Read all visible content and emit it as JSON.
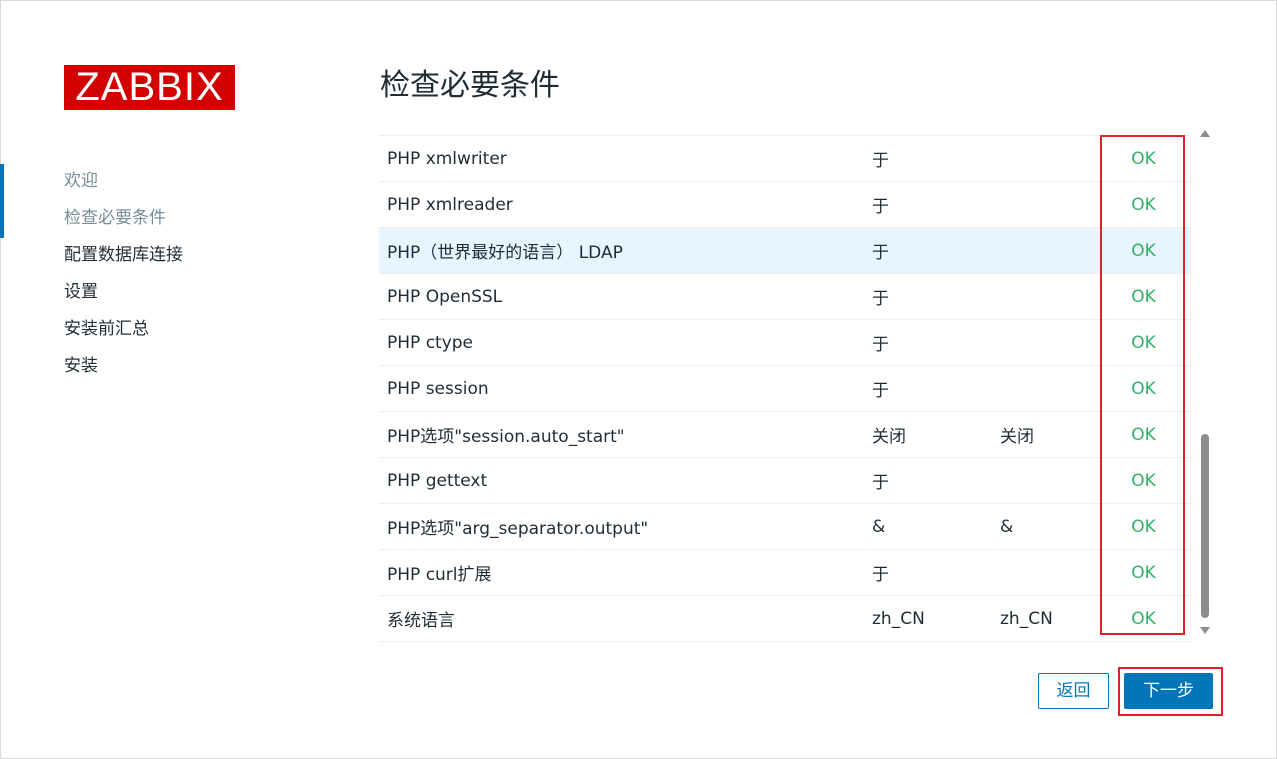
{
  "logo": "ZABBIX",
  "nav": {
    "items": [
      {
        "label": "欢迎",
        "state": "done"
      },
      {
        "label": "检查必要条件",
        "state": "current"
      },
      {
        "label": "配置数据库连接",
        "state": "pending"
      },
      {
        "label": "设置",
        "state": "pending"
      },
      {
        "label": "安装前汇总",
        "state": "pending"
      },
      {
        "label": "安装",
        "state": "pending"
      }
    ]
  },
  "page": {
    "title": "检查必要条件"
  },
  "requirements": {
    "rows": [
      {
        "name": "PHP xmlwriter",
        "current": "于",
        "required": "",
        "status": "OK"
      },
      {
        "name": "PHP xmlreader",
        "current": "于",
        "required": "",
        "status": "OK"
      },
      {
        "name": "PHP（世界最好的语言） LDAP",
        "current": "于",
        "required": "",
        "status": "OK"
      },
      {
        "name": "PHP OpenSSL",
        "current": "于",
        "required": "",
        "status": "OK"
      },
      {
        "name": "PHP ctype",
        "current": "于",
        "required": "",
        "status": "OK"
      },
      {
        "name": "PHP session",
        "current": "于",
        "required": "",
        "status": "OK"
      },
      {
        "name": "PHP选项\"session.auto_start\"",
        "current": "关闭",
        "required": "关闭",
        "status": "OK"
      },
      {
        "name": "PHP gettext",
        "current": "于",
        "required": "",
        "status": "OK"
      },
      {
        "name": "PHP选项\"arg_separator.output\"",
        "current": "&",
        "required": "&",
        "status": "OK"
      },
      {
        "name": "PHP curl扩展",
        "current": "于",
        "required": "",
        "status": "OK"
      },
      {
        "name": "系统语言",
        "current": "zh_CN",
        "required": "zh_CN",
        "status": "OK"
      }
    ],
    "highlighted_row": "PHP（世界最好的语言） LDAP"
  },
  "buttons": {
    "back": "返回",
    "next": "下一步"
  },
  "colors": {
    "brand": "#d40000",
    "accent": "#0275b8",
    "ok": "#34af67",
    "annotation": "#e0202a"
  }
}
